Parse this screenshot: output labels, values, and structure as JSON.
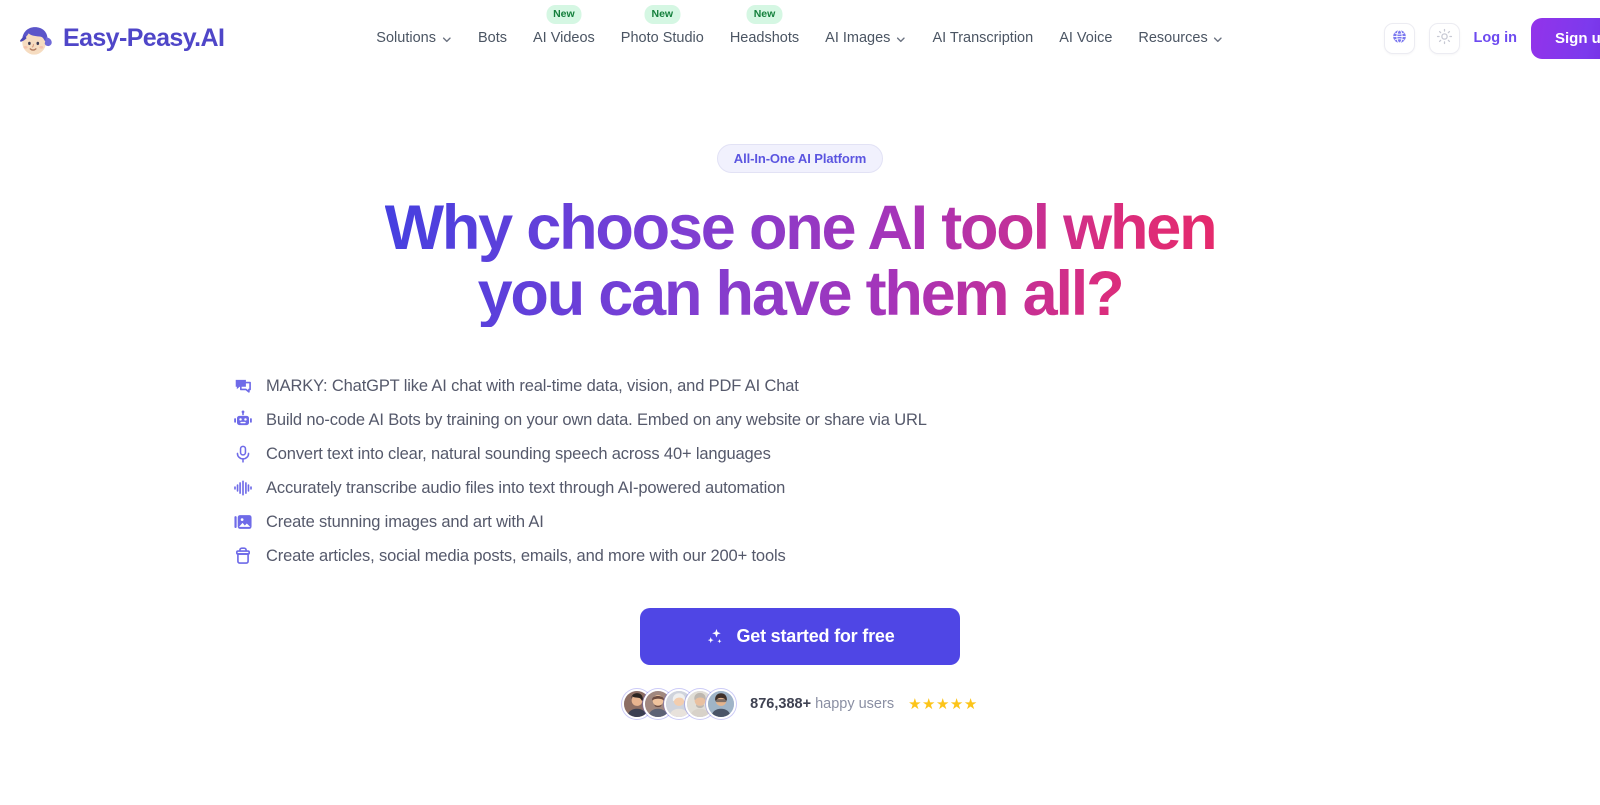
{
  "brand": {
    "name": "Easy-Peasy.AI",
    "logo_icon": "mascot-face-icon"
  },
  "nav": {
    "items": [
      {
        "label": "Solutions",
        "has_dropdown": true,
        "badge": null
      },
      {
        "label": "Bots",
        "has_dropdown": false,
        "badge": null
      },
      {
        "label": "AI Videos",
        "has_dropdown": false,
        "badge": "New"
      },
      {
        "label": "Photo Studio",
        "has_dropdown": false,
        "badge": "New"
      },
      {
        "label": "Headshots",
        "has_dropdown": false,
        "badge": "New"
      },
      {
        "label": "AI Images",
        "has_dropdown": true,
        "badge": null
      },
      {
        "label": "AI Transcription",
        "has_dropdown": false,
        "badge": null
      },
      {
        "label": "AI Voice",
        "has_dropdown": false,
        "badge": null
      },
      {
        "label": "Resources",
        "has_dropdown": true,
        "badge": null
      }
    ],
    "language_icon": "globe-icon",
    "theme_icon": "sun-icon",
    "login_label": "Log in",
    "signup_label": "Sign up"
  },
  "hero": {
    "pill_label": "All-In-One AI Platform",
    "headline_line1": "Why choose one AI tool when",
    "headline_line2": "you can have them all?",
    "features": [
      {
        "icon": "chat-bubble-icon",
        "text": "MARKY: ChatGPT like AI chat with real-time data, vision, and PDF AI Chat"
      },
      {
        "icon": "robot-icon",
        "text": "Build no-code AI Bots by training on your own data. Embed on any website or share via URL"
      },
      {
        "icon": "microphone-icon",
        "text": "Convert text into clear, natural sounding speech across 40+ languages"
      },
      {
        "icon": "waveform-icon",
        "text": "Accurately transcribe audio files into text through AI-powered automation"
      },
      {
        "icon": "image-icon",
        "text": "Create stunning images and art with AI"
      },
      {
        "icon": "toolbox-icon",
        "text": "Create articles, social media posts, emails, and more with our 200+ tools"
      }
    ],
    "cta_label": "Get started for free",
    "cta_icon": "sparkles-icon",
    "proof_count": "876,388+",
    "proof_label": "happy users",
    "stars": "★★★★★",
    "avatar_count": 5
  },
  "colors": {
    "brand_purple": "#4f46c8",
    "accent_indigo": "#4f46e5",
    "link_purple": "#6d4af0",
    "badge_green_bg": "#d5f7e3",
    "badge_green_text": "#15803d",
    "star_gold": "#fcc419",
    "pill_bg": "#f1f1fd",
    "pill_text": "#5b55e0"
  }
}
